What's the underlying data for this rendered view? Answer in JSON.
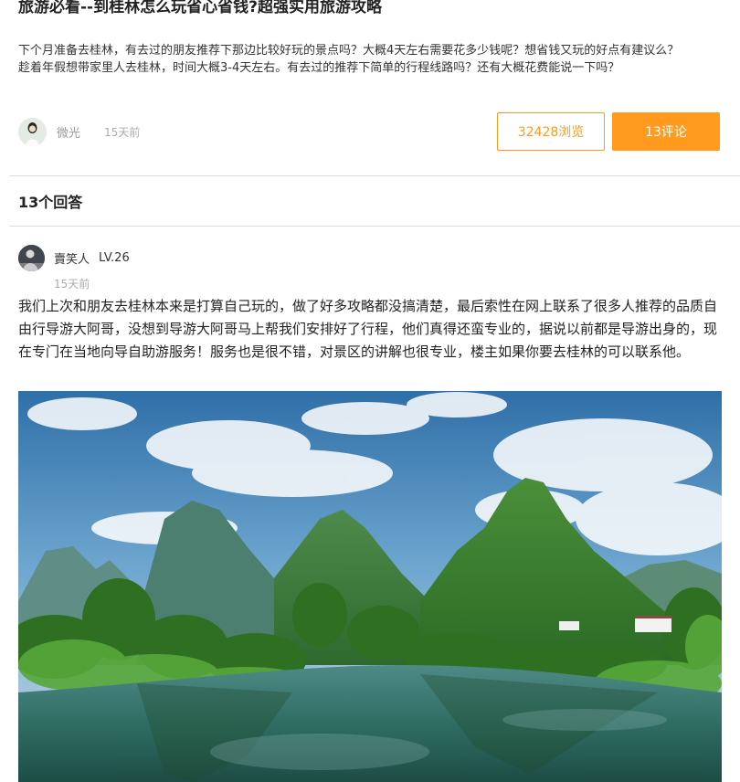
{
  "question": {
    "title": "旅游必看--到桂林怎么玩省心省钱?超强实用旅游攻略",
    "description_lines": [
      "下个月准备去桂林，有去过的朋友推荐下那边比较好玩的景点吗？大概4天左右需要花多少钱呢？想省钱又玩的好点有建议么？",
      "趁着年假想带家里人去桂林，时间大概3-4天左右。有去过的推荐下简单的行程线路吗？还有大概花费能说一下吗？"
    ],
    "author": "微光",
    "time": "15天前",
    "views_label": "32428浏览",
    "comments_label": "13评论"
  },
  "answers_header": "13个回答",
  "answer": {
    "username": "賣笑人",
    "level": "LV.26",
    "time": "15天前",
    "text": "我们上次和朋友去桂林本来是打算自己玩的，做了好多攻略都没搞清楚，最后索性在网上联系了很多人推荐的品质自由行导游大阿哥，没想到导游大阿哥马上帮我们安排好了行程，他们真得还蛮专业的，据说以前都是导游出身的，现在专门在当地向导自助游服务！服务也是很不错，对景区的讲解也很专业，楼主如果你要去桂林的可以联系他。"
  },
  "colors": {
    "accent": "#ff9a1e",
    "divider": "#dcdcdc"
  },
  "icons": {
    "author_avatar": "user-avatar",
    "answer_avatar": "user-avatar"
  }
}
